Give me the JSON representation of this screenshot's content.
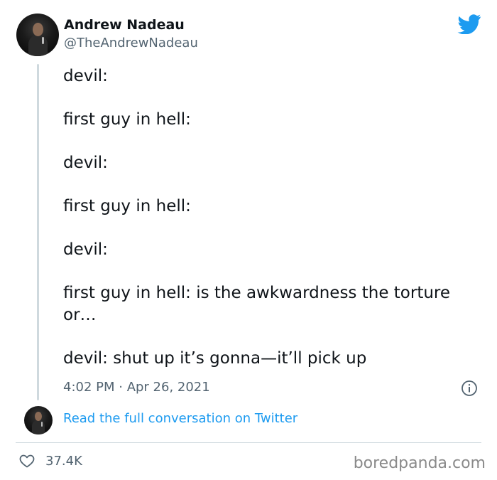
{
  "tweet": {
    "author_name": "Andrew Nadeau",
    "author_handle": "@TheAndrewNadeau",
    "lines": [
      "devil:",
      "first guy in hell:",
      "devil:",
      "first guy in hell:",
      "devil:",
      "first guy in hell: is the awkwardness the torture or…",
      "devil: shut up it’s gonna—it’ll pick up"
    ],
    "timestamp": "4:02 PM · Apr 26, 2021",
    "read_more_label": "Read the full conversation on Twitter",
    "like_count": "37.4K"
  },
  "icons": {
    "brand": "twitter-bird-icon",
    "info": "info-icon",
    "like": "heart-icon"
  },
  "colors": {
    "twitter_blue": "#1d9bf0",
    "muted_text": "#536471",
    "divider": "#cfd9de"
  },
  "watermark": "boredpanda.com"
}
